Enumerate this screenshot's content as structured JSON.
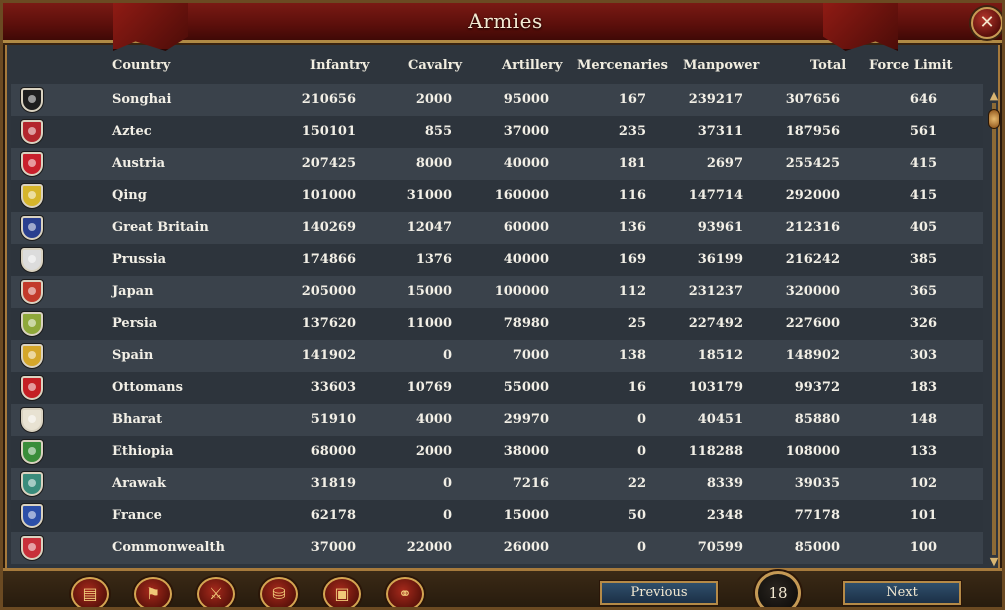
{
  "window": {
    "title": "Armies",
    "close_symbol": "✕"
  },
  "columns": {
    "country": "Country",
    "infantry": "Infantry",
    "cavalry": "Cavalry",
    "artillery": "Artillery",
    "mercenaries": "Mercenaries",
    "manpower": "Manpower",
    "total": "Total",
    "force_limit": "Force Limit"
  },
  "rows": [
    {
      "country": "Songhai",
      "infantry": "210656",
      "cavalry": "2000",
      "artillery": "95000",
      "mercenaries": "167",
      "manpower": "239217",
      "total": "307656",
      "force_limit": "646",
      "flag_color": "#1e1e1e"
    },
    {
      "country": "Aztec",
      "infantry": "150101",
      "cavalry": "855",
      "artillery": "37000",
      "mercenaries": "235",
      "manpower": "37311",
      "total": "187956",
      "force_limit": "561",
      "flag_color": "#b3262d"
    },
    {
      "country": "Austria",
      "infantry": "207425",
      "cavalry": "8000",
      "artillery": "40000",
      "mercenaries": "181",
      "manpower": "2697",
      "total": "255425",
      "force_limit": "415",
      "flag_color": "#c9202c"
    },
    {
      "country": "Qing",
      "infantry": "101000",
      "cavalry": "31000",
      "artillery": "160000",
      "mercenaries": "116",
      "manpower": "147714",
      "total": "292000",
      "force_limit": "415",
      "flag_color": "#d6b52a"
    },
    {
      "country": "Great Britain",
      "infantry": "140269",
      "cavalry": "12047",
      "artillery": "60000",
      "mercenaries": "136",
      "manpower": "93961",
      "total": "212316",
      "force_limit": "405",
      "flag_color": "#2a3f8f"
    },
    {
      "country": "Prussia",
      "infantry": "174866",
      "cavalry": "1376",
      "artillery": "40000",
      "mercenaries": "169",
      "manpower": "36199",
      "total": "216242",
      "force_limit": "385",
      "flag_color": "#dcdcdc"
    },
    {
      "country": "Japan",
      "infantry": "205000",
      "cavalry": "15000",
      "artillery": "100000",
      "mercenaries": "112",
      "manpower": "231237",
      "total": "320000",
      "force_limit": "365",
      "flag_color": "#c23a2a"
    },
    {
      "country": "Persia",
      "infantry": "137620",
      "cavalry": "11000",
      "artillery": "78980",
      "mercenaries": "25",
      "manpower": "227492",
      "total": "227600",
      "force_limit": "326",
      "flag_color": "#8fa83a"
    },
    {
      "country": "Spain",
      "infantry": "141902",
      "cavalry": "0",
      "artillery": "7000",
      "mercenaries": "138",
      "manpower": "18512",
      "total": "148902",
      "force_limit": "303",
      "flag_color": "#d4a62a"
    },
    {
      "country": "Ottomans",
      "infantry": "33603",
      "cavalry": "10769",
      "artillery": "55000",
      "mercenaries": "16",
      "manpower": "103179",
      "total": "99372",
      "force_limit": "183",
      "flag_color": "#c41f24"
    },
    {
      "country": "Bharat",
      "infantry": "51910",
      "cavalry": "4000",
      "artillery": "29970",
      "mercenaries": "0",
      "manpower": "40451",
      "total": "85880",
      "force_limit": "148",
      "flag_color": "#e8e2d2"
    },
    {
      "country": "Ethiopia",
      "infantry": "68000",
      "cavalry": "2000",
      "artillery": "38000",
      "mercenaries": "0",
      "manpower": "118288",
      "total": "108000",
      "force_limit": "133",
      "flag_color": "#3a8d3a"
    },
    {
      "country": "Arawak",
      "infantry": "31819",
      "cavalry": "0",
      "artillery": "7216",
      "mercenaries": "22",
      "manpower": "8339",
      "total": "39035",
      "force_limit": "102",
      "flag_color": "#3a8c7c"
    },
    {
      "country": "France",
      "infantry": "62178",
      "cavalry": "0",
      "artillery": "15000",
      "mercenaries": "50",
      "manpower": "2348",
      "total": "77178",
      "force_limit": "101",
      "flag_color": "#2c4fa8"
    },
    {
      "country": "Commonwealth",
      "infantry": "37000",
      "cavalry": "22000",
      "artillery": "26000",
      "mercenaries": "0",
      "manpower": "70599",
      "total": "85000",
      "force_limit": "100",
      "flag_color": "#c8303a"
    }
  ],
  "pager": {
    "previous_label": "Previous",
    "next_label": "Next",
    "page": "18"
  },
  "toolbar": [
    {
      "icon": "ledger-icon",
      "glyph": "▤"
    },
    {
      "icon": "flag-icon",
      "glyph": "⚑"
    },
    {
      "icon": "crossed-swords-icon",
      "glyph": "⚔"
    },
    {
      "icon": "coins-icon",
      "glyph": "⛁"
    },
    {
      "icon": "trade-goods-icon",
      "glyph": "▣"
    },
    {
      "icon": "handshake-icon",
      "glyph": "⚭"
    }
  ],
  "colors": {
    "title_red": "#5b0f0b",
    "gold": "#b08a45",
    "row_light": "#3a424b",
    "row_dark": "#2d343c"
  }
}
